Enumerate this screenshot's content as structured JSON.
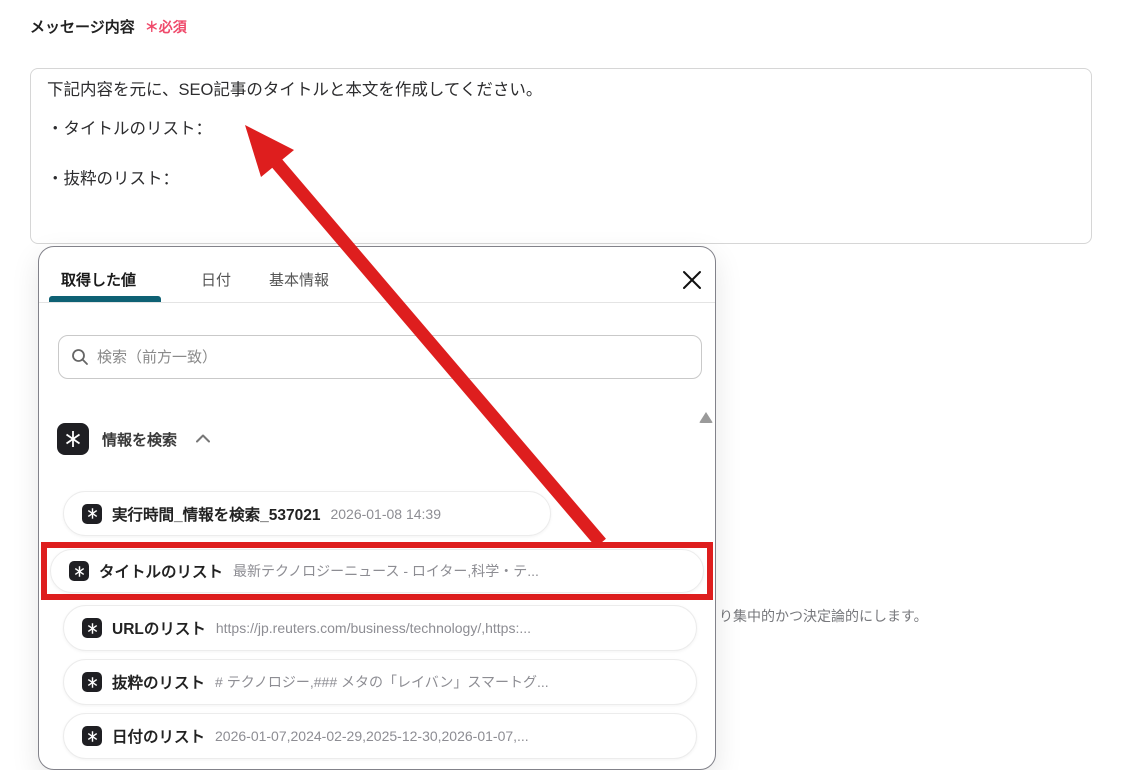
{
  "field": {
    "label": "メッセージ内容",
    "required_badge": "＊必須",
    "textarea": {
      "line1": "下記内容を元に、SEO記事のタイトルと本文を作成してください。",
      "line2": "・タイトルのリスト：",
      "line3": "・抜粋のリスト："
    }
  },
  "background_fragment": "り集中的かつ決定論的にします。",
  "modal": {
    "tabs": [
      {
        "label": "取得した値",
        "active": true
      },
      {
        "label": "日付",
        "active": false
      },
      {
        "label": "基本情報",
        "active": false
      }
    ],
    "search": {
      "placeholder": "検索（前方一致）"
    },
    "section": {
      "label": "情報を検索"
    },
    "items": [
      {
        "label": "実行時間_情報を検索_537021",
        "value": "2026-01-08 14:39",
        "highlighted": false
      },
      {
        "label": "タイトルのリスト",
        "value": "最新テクノロジーニュース - ロイター,科学・テ...",
        "highlighted": true
      },
      {
        "label": "URLのリスト",
        "value": "https://jp.reuters.com/business/technology/,https:...",
        "highlighted": false
      },
      {
        "label": "抜粋のリスト",
        "value": "# テクノロジー,### メタの「レイバン」スマートグ...",
        "highlighted": false
      },
      {
        "label": "日付のリスト",
        "value": "2026-01-07,2024-02-29,2025-12-30,2026-01-07,...",
        "highlighted": false
      }
    ]
  },
  "colors": {
    "accent_red": "#de1e1e",
    "required_red": "#ef4a6b",
    "tab_underline": "#0e6174",
    "icon_bg": "#1f1f23",
    "text_dark": "#1f1f21",
    "text_gray": "#8d8d93",
    "modal_border": "#82828a"
  }
}
